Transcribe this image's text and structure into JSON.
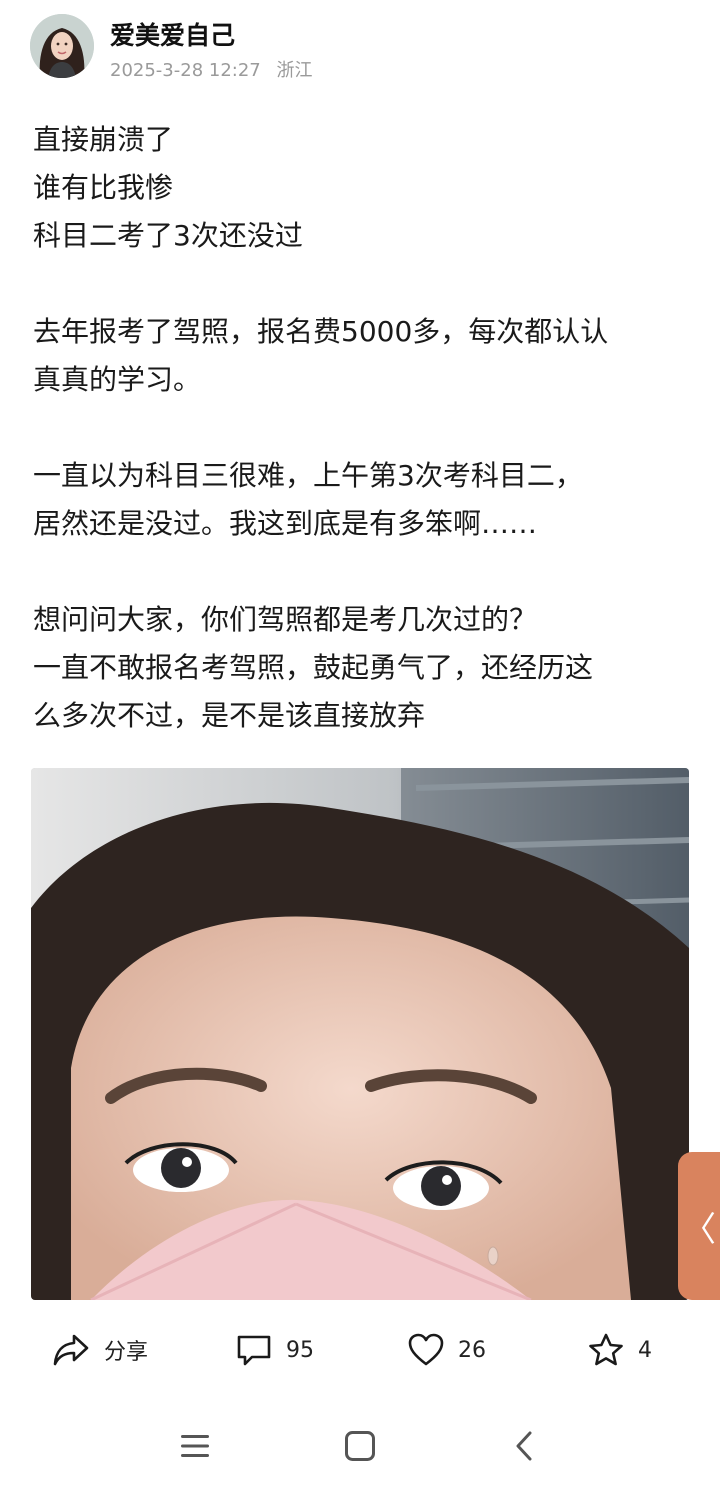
{
  "post": {
    "author": {
      "name": "爱美爱自己",
      "date": "2025-3-28 12:27",
      "location": "浙江"
    },
    "paragraphs": [
      [
        "直接崩溃了",
        "谁有比我惨",
        "科目二考了3次还没过"
      ],
      [
        "去年报考了驾照，报名费5000多，每次都认认",
        "真真的学习。"
      ],
      [
        "一直以为科目三很难，上午第3次考科目二，",
        "居然还是没过。我这到底是有多笨啊……"
      ],
      [
        "想问问大家，你们驾照都是考几次过的？",
        "一直不敢报名考驾照，鼓起勇气了，还经历这",
        "么多次不过，是不是该直接放弃"
      ]
    ]
  },
  "side_tab": {
    "glyph": "〈"
  },
  "actions": {
    "share": {
      "icon": "share-icon",
      "label": "分享"
    },
    "comment": {
      "icon": "comment-icon",
      "count": "95"
    },
    "like": {
      "icon": "heart-icon",
      "count": "26"
    },
    "favorite": {
      "icon": "star-icon",
      "count": "4"
    }
  },
  "navbar": {
    "items": [
      "menu-icon",
      "home-square-icon",
      "back-chevron-icon"
    ]
  },
  "colors": {
    "text": "#1a1a1a",
    "meta": "#9a9a9a",
    "accent_tab": "#d9835e",
    "mask_pink": "#f2c9cc"
  }
}
